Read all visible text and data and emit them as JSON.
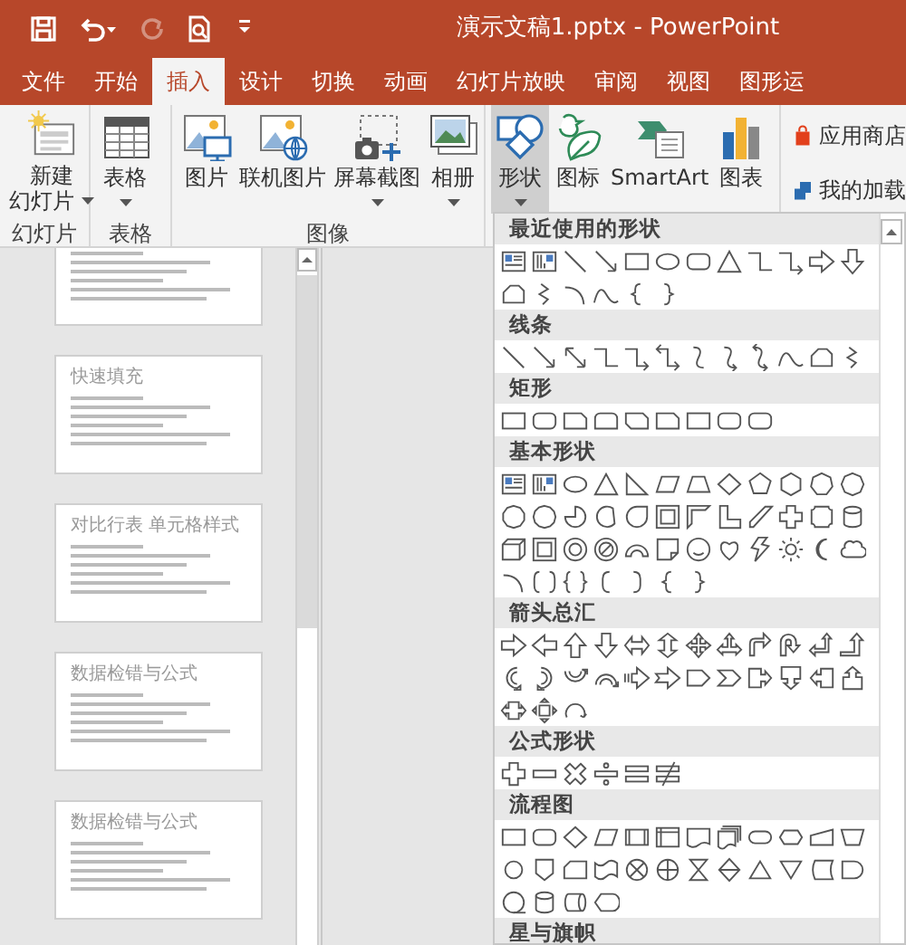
{
  "window": {
    "title": "演示文稿1.pptx  -  PowerPoint"
  },
  "quick_access": [
    {
      "kind": "save",
      "disabled": false
    },
    {
      "kind": "undo",
      "disabled": false
    },
    {
      "kind": "redo",
      "disabled": true
    },
    {
      "kind": "preview",
      "disabled": false
    },
    {
      "kind": "customize",
      "disabled": false
    }
  ],
  "tabs": [
    {
      "label": "文件",
      "selected": false
    },
    {
      "label": "开始",
      "selected": false
    },
    {
      "label": "插入",
      "selected": true
    },
    {
      "label": "设计",
      "selected": false
    },
    {
      "label": "切换",
      "selected": false
    },
    {
      "label": "动画",
      "selected": false
    },
    {
      "label": "幻灯片放映",
      "selected": false
    },
    {
      "label": "审阅",
      "selected": false
    },
    {
      "label": "视图",
      "selected": false
    },
    {
      "label": "图形运",
      "selected": false
    }
  ],
  "ribbon": {
    "groups": [
      {
        "label": "幻灯片",
        "buttons": [
          {
            "kind": "new-slide",
            "lines": [
              "新建",
              "幻灯片"
            ],
            "dropdown": true,
            "pressed": false
          }
        ]
      },
      {
        "label": "表格",
        "buttons": [
          {
            "kind": "table",
            "lines": [
              "表格"
            ],
            "dropdown": true,
            "pressed": false
          }
        ]
      },
      {
        "label": "图像",
        "buttons": [
          {
            "kind": "picture",
            "lines": [
              "图片"
            ],
            "dropdown": false,
            "pressed": false
          },
          {
            "kind": "online-picture",
            "lines": [
              "联机图片"
            ],
            "dropdown": false,
            "pressed": false
          },
          {
            "kind": "screenshot",
            "lines": [
              "屏幕截图"
            ],
            "dropdown": true,
            "pressed": false
          },
          {
            "kind": "album",
            "lines": [
              "相册"
            ],
            "dropdown": true,
            "pressed": false
          }
        ]
      },
      {
        "buttons": [
          {
            "kind": "shapes",
            "lines": [
              "形状"
            ],
            "dropdown": true,
            "pressed": true
          },
          {
            "kind": "icons",
            "lines": [
              "图标"
            ],
            "dropdown": false,
            "pressed": false
          },
          {
            "kind": "smartart",
            "lines": [
              "SmartArt"
            ],
            "dropdown": false,
            "pressed": false
          },
          {
            "kind": "chart",
            "lines": [
              "图表"
            ],
            "dropdown": false,
            "pressed": false
          }
        ]
      },
      {
        "items": [
          {
            "kind": "store",
            "label": "应用商店"
          },
          {
            "kind": "addins",
            "label": "我的加载"
          }
        ]
      }
    ]
  },
  "slides": [
    {
      "kind": "partial"
    },
    {
      "kind": "full",
      "title": "快速填充"
    },
    {
      "kind": "full",
      "title": "对比行表 单元格样式"
    },
    {
      "kind": "full",
      "title": "数据检错与公式"
    },
    {
      "kind": "full",
      "title": "数据检错与公式"
    }
  ],
  "shape_gallery": {
    "sections": [
      {
        "kind": "recent",
        "title": "最近使用的形状"
      },
      {
        "kind": "lines",
        "title": "线条"
      },
      {
        "kind": "rectangles",
        "title": "矩形"
      },
      {
        "kind": "basic",
        "title": "基本形状"
      },
      {
        "kind": "arrows",
        "title": "箭头总汇"
      },
      {
        "kind": "equation",
        "title": "公式形状"
      },
      {
        "kind": "flowchart",
        "title": "流程图"
      },
      {
        "kind": "stars",
        "title": "星与旗帜"
      }
    ]
  }
}
